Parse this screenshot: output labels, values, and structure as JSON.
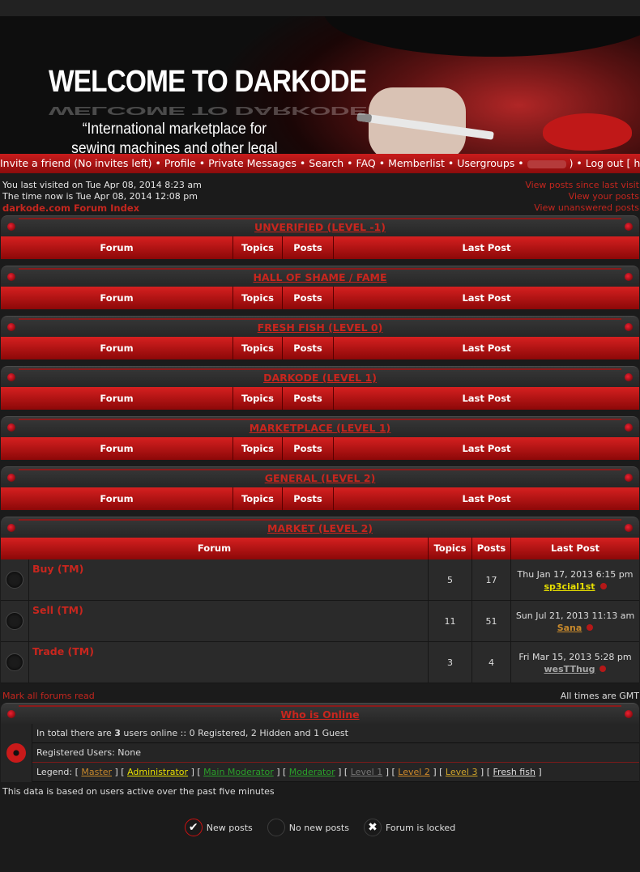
{
  "banner": {
    "title": "WELCOME TO DARKODE",
    "tagline_1": "“International marketplace for",
    "tagline_2": "sewing machines and other legal stuff”"
  },
  "nav": {
    "invite": "Invite a friend (No invites left)",
    "profile": "Profile",
    "pm": "Private Messages",
    "search": "Search",
    "faq": "FAQ",
    "memberlist": "Memberlist",
    "usergroups": "Usergroups",
    "logout": "Log out [ hidden ]"
  },
  "info": {
    "last_visit": "You last visited on Tue Apr 08, 2014 8:23 am",
    "now": "The time now is Tue Apr 08, 2014 12:08 pm",
    "index": "darkode.com Forum Index",
    "links": [
      "View posts since last visit",
      "View your posts",
      "View unanswered posts"
    ]
  },
  "columns": {
    "forum": "Forum",
    "topics": "Topics",
    "posts": "Posts",
    "last": "Last Post"
  },
  "categories": [
    {
      "title": "UNVERIFIED (LEVEL -1)"
    },
    {
      "title": "HALL OF SHAME / FAME"
    },
    {
      "title": "FRESH FISH (LEVEL 0)"
    },
    {
      "title": "DARKODE (LEVEL 1)"
    },
    {
      "title": "MARKETPLACE (LEVEL 1)"
    },
    {
      "title": "GENERAL (LEVEL 2)"
    }
  ],
  "market": {
    "title": "MARKET (LEVEL 2)",
    "forums": [
      {
        "name": "Buy (TM)",
        "topics": "5",
        "posts": "17",
        "date": "Thu Jan 17, 2013 6:15 pm",
        "user": "sp3cial1st",
        "user_color": "#e8e000"
      },
      {
        "name": "Sell (TM)",
        "topics": "11",
        "posts": "51",
        "date": "Sun Jul 21, 2013 11:13 am",
        "user": "Sana",
        "user_color": "#c7892c"
      },
      {
        "name": "Trade (TM)",
        "topics": "3",
        "posts": "4",
        "date": "Fri Mar 15, 2013 5:28 pm",
        "user": "wesTThug",
        "user_color": "#a8a8a8"
      }
    ]
  },
  "below": {
    "mark_read": "Mark all forums read",
    "timezone": "All times are GMT"
  },
  "online": {
    "title": "Who is Online",
    "total_pre": "In total there are",
    "total_count": "3",
    "total_post": "users online :: 0 Registered, 2 Hidden and 1 Guest",
    "registered": "Registered Users: None",
    "legend_label": "Legend:",
    "legend": [
      {
        "name": "Master",
        "color": "#c7892c"
      },
      {
        "name": "Administrator",
        "color": "#e8e000"
      },
      {
        "name": "Main Moderator",
        "color": "#2aa12a"
      },
      {
        "name": "Moderator",
        "color": "#2aa12a"
      },
      {
        "name": "Level 1",
        "color": "#777777"
      },
      {
        "name": "Level 2",
        "color": "#d08a2a"
      },
      {
        "name": "Level 3",
        "color": "#d0a52a"
      },
      {
        "name": "Fresh fish",
        "color": "#dddddd"
      }
    ],
    "based": "This data is based on users active over the past five minutes"
  },
  "keys": {
    "new": "New posts",
    "no_new": "No new posts",
    "locked": "Forum is locked"
  }
}
